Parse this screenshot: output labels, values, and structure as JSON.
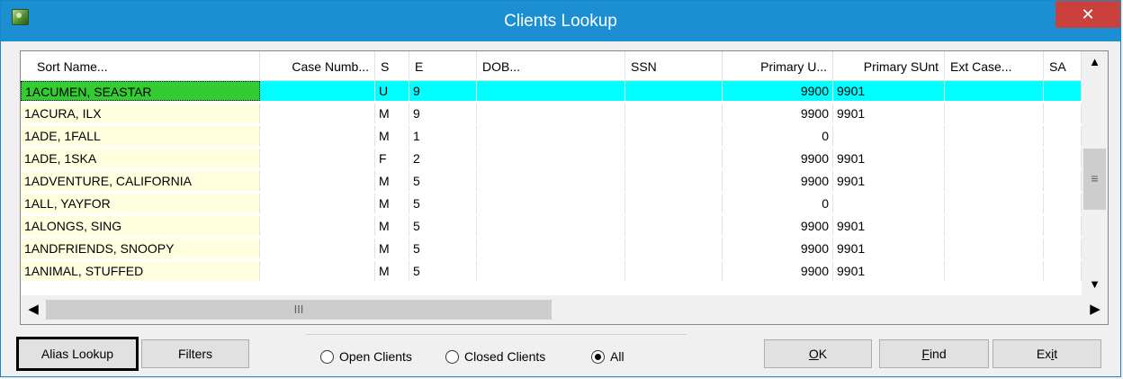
{
  "window": {
    "title": "Clients Lookup",
    "close": "✕"
  },
  "grid": {
    "columns": [
      "Sort Name...",
      "Case Numb...",
      "S",
      "E",
      "DOB...",
      "SSN",
      "Primary U...",
      "Primary SUnt",
      "Ext Case...",
      "SA"
    ],
    "rows": [
      {
        "name": "1ACUMEN, SEASTAR",
        "case": "",
        "s": "U",
        "e": "9",
        "dob": "",
        "ssn": "",
        "pu": "9900",
        "ps": "9901",
        "ext": "",
        "sa": "",
        "selected": true
      },
      {
        "name": "1ACURA, ILX",
        "case": "",
        "s": "M",
        "e": "9",
        "dob": "",
        "ssn": "",
        "pu": "9900",
        "ps": "9901",
        "ext": "",
        "sa": ""
      },
      {
        "name": "1ADE, 1FALL",
        "case": "",
        "s": "M",
        "e": "1",
        "dob": "",
        "ssn": "",
        "pu": "0",
        "ps": "",
        "ext": "",
        "sa": ""
      },
      {
        "name": "1ADE, 1SKA",
        "case": "",
        "s": "F",
        "e": "2",
        "dob": "",
        "ssn": "",
        "pu": "9900",
        "ps": "9901",
        "ext": "",
        "sa": ""
      },
      {
        "name": "1ADVENTURE, CALIFORNIA",
        "case": "",
        "s": "M",
        "e": "5",
        "dob": "",
        "ssn": "",
        "pu": "9900",
        "ps": "9901",
        "ext": "",
        "sa": ""
      },
      {
        "name": "1ALL, YAYFOR",
        "case": "",
        "s": "M",
        "e": "5",
        "dob": "",
        "ssn": "",
        "pu": "0",
        "ps": "",
        "ext": "",
        "sa": ""
      },
      {
        "name": "1ALONGS, SING",
        "case": "",
        "s": "M",
        "e": "5",
        "dob": "",
        "ssn": "",
        "pu": "9900",
        "ps": "9901",
        "ext": "",
        "sa": ""
      },
      {
        "name": "1ANDFRIENDS, SNOOPY",
        "case": "",
        "s": "M",
        "e": "5",
        "dob": "",
        "ssn": "",
        "pu": "9900",
        "ps": "9901",
        "ext": "",
        "sa": ""
      },
      {
        "name": "1ANIMAL, STUFFED",
        "case": "",
        "s": "M",
        "e": "5",
        "dob": "",
        "ssn": "",
        "pu": "9900",
        "ps": "9901",
        "ext": "",
        "sa": ""
      }
    ],
    "scroll": {
      "up": "▲",
      "down": "▼",
      "left": "◀",
      "right": "▶",
      "vthumb_grip": "≡",
      "hthumb_grip": "III"
    }
  },
  "buttons": {
    "alias": "Alias Lookup",
    "filters": "Filters",
    "ok_mnemonic": "O",
    "ok_rest": "K",
    "find_mnemonic": "F",
    "find_rest": "ind",
    "exit_pre": "Ex",
    "exit_mnemonic": "i",
    "exit_post": "t"
  },
  "filter": {
    "options": [
      "Open Clients",
      "Closed Clients",
      "All"
    ],
    "selected": "All"
  },
  "icons": {
    "app": "app-icon",
    "close": "close-icon"
  },
  "colors": {
    "titlebar": "#1c8fd3",
    "close": "#c9413a",
    "selected_row": "#00ffff",
    "selected_name": "#33cc33",
    "sort_column": "#ffffe0"
  }
}
